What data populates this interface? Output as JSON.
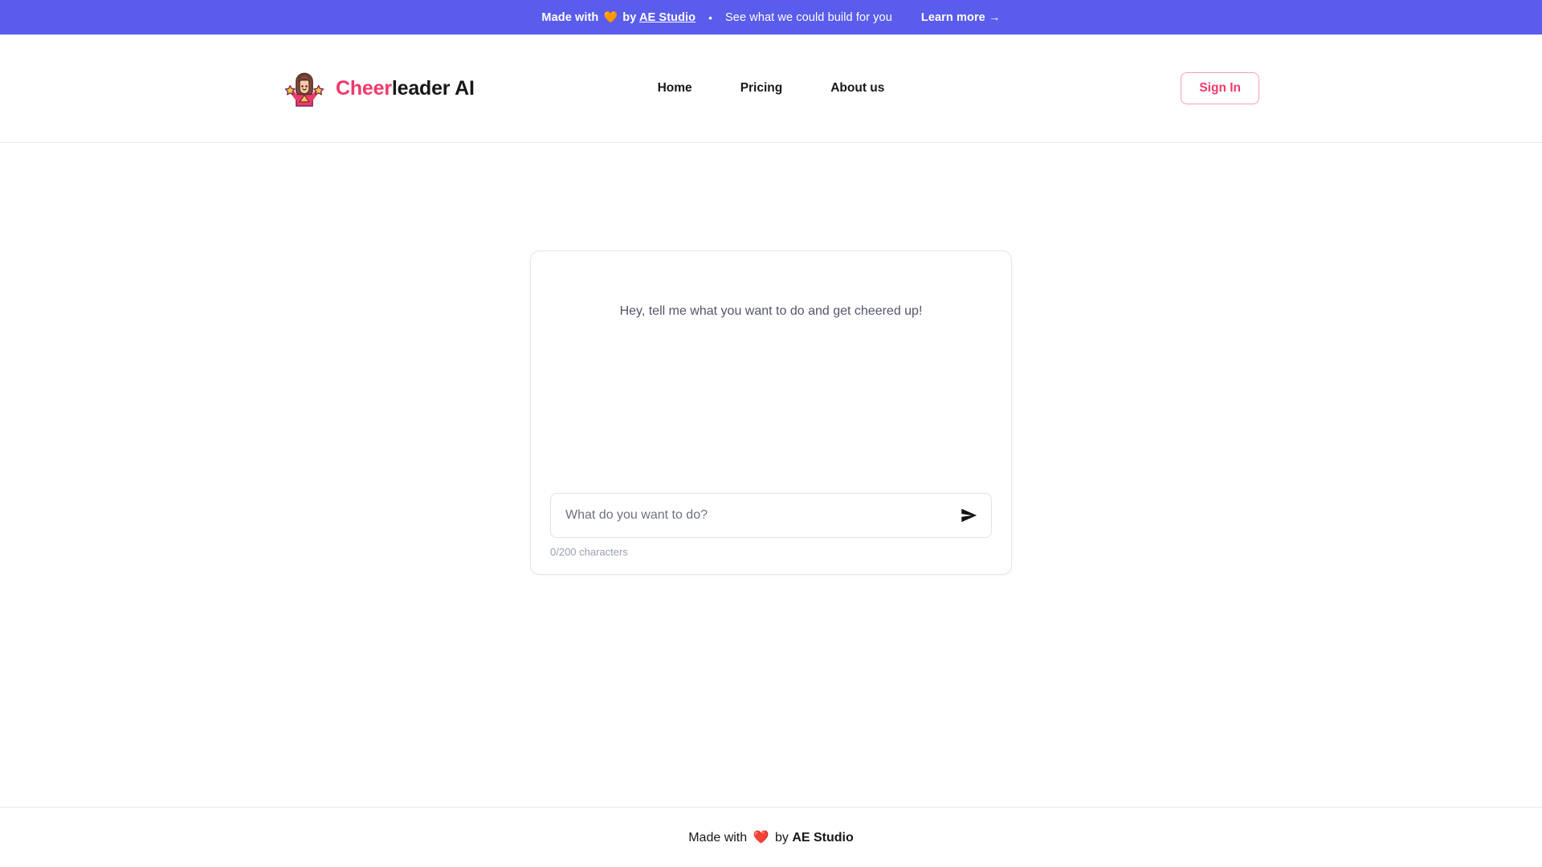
{
  "promo_banner": {
    "prefix": "Made with",
    "heart": "🧡",
    "by": "by",
    "studio_link": "AE Studio",
    "separator": "•",
    "subtitle": "See what we could build for you",
    "cta": "Learn more →",
    "background_color": "#5a5ceb",
    "text_color": "#ffffff"
  },
  "header": {
    "brand": {
      "icon": "cheerleader-icon",
      "name_accent": "Cheer",
      "name_rest": "leader AI",
      "accent_color": "#ef3a6b"
    },
    "nav": [
      {
        "label": "Home",
        "name": "home"
      },
      {
        "label": "Pricing",
        "name": "pricing"
      },
      {
        "label": "About us",
        "name": "about-us"
      }
    ],
    "signin_label": "Sign In",
    "signin_color": "#ef3a6b",
    "signin_border_color": "#f3a0b8"
  },
  "chat": {
    "greeting": "Hey, tell me what you want to do and get cheered up!",
    "input_value": "",
    "input_placeholder": "What do you want to do?",
    "send_icon": "send-icon",
    "char_counter": "0/200 characters",
    "char_current": 0,
    "char_limit": 200
  },
  "footer": {
    "prefix": "Made with",
    "heart": "❤️",
    "by": "by",
    "studio": "AE Studio"
  }
}
